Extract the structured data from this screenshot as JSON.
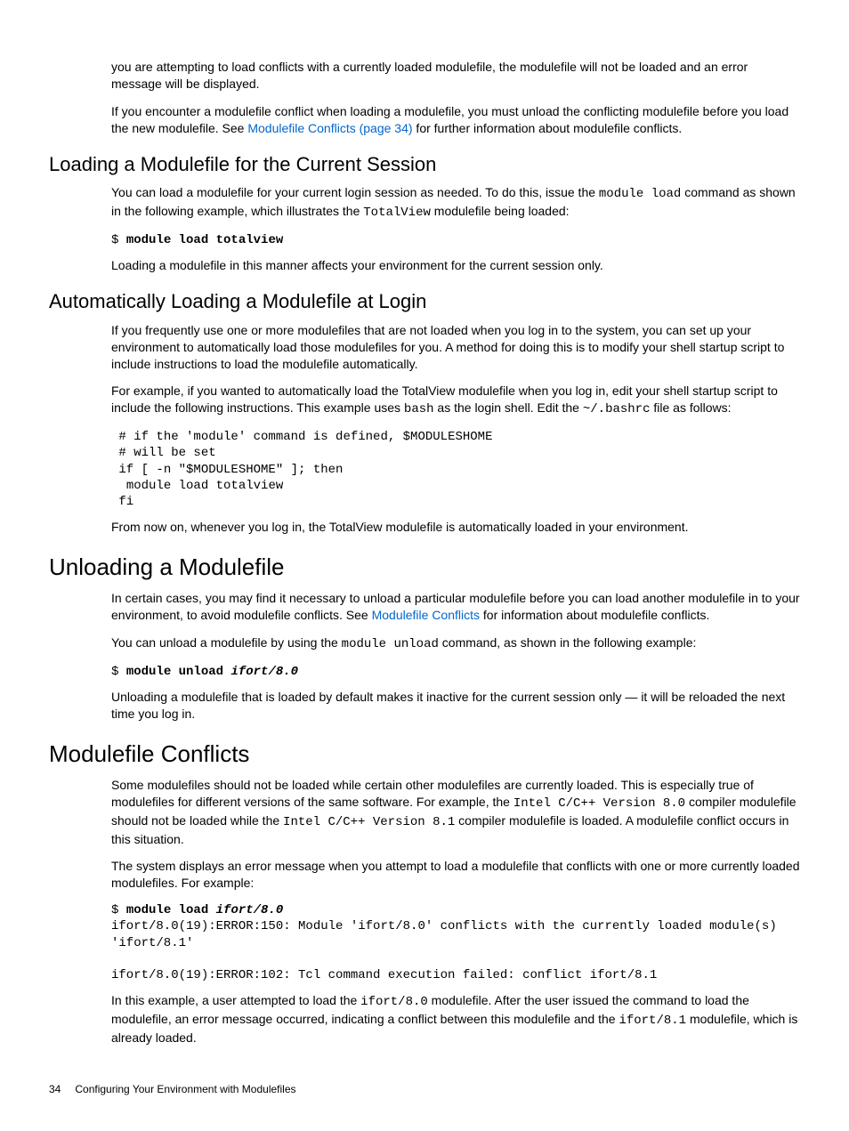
{
  "intro": {
    "p1": "you are attempting to load conflicts with a currently loaded modulefile, the modulefile will not be loaded and an error message will be displayed.",
    "p2a": "If you encounter a modulefile conflict when loading a modulefile, you must unload the conflicting modulefile before you load the new modulefile. See ",
    "p2link": "Modulefile Conflicts (page 34)",
    "p2b": " for further information about modulefile conflicts."
  },
  "loadingSession": {
    "heading": "Loading a Modulefile for the Current Session",
    "p1a": "You can load a modulefile for your current login session as needed. To do this, issue the ",
    "p1code1": "module load",
    "p1b": " command as shown in the following example, which illustrates the ",
    "p1code2": "TotalView",
    "p1c": " modulefile being loaded:",
    "cmdPrompt": "$ ",
    "cmd": "module load totalview",
    "p2": "Loading a modulefile in this manner affects your environment for the current session only."
  },
  "autoLoading": {
    "heading": "Automatically Loading a Modulefile at Login",
    "p1": "If you frequently use one or more modulefiles that are not loaded when you log in to the system, you can set up your environment to automatically load those modulefiles for you. A method for doing this is to modify your shell startup script to include instructions to load the modulefile automatically.",
    "p2a": "For example, if you wanted to automatically load the TotalView modulefile when you log in, edit your shell startup script to include the following instructions. This example uses ",
    "p2code1": "bash",
    "p2b": " as the login shell. Edit the ",
    "p2code2": "~/.bashrc",
    "p2c": " file as follows:",
    "code": " # if the 'module' command is defined, $MODULESHOME\n # will be set\n if [ -n \"$MODULESHOME\" ]; then\n  module load totalview\n fi",
    "p3": "From now on, whenever you log in, the TotalView modulefile is automatically loaded in your environment."
  },
  "unloading": {
    "heading": "Unloading a Modulefile",
    "p1a": "In certain cases, you may find it necessary to unload a particular modulefile before you can load another modulefile in to your environment, to avoid modulefile conflicts. See ",
    "p1link": "Modulefile Conflicts",
    "p1b": " for information about modulefile conflicts.",
    "p2a": "You can unload a modulefile by using the ",
    "p2code": "module unload",
    "p2b": " command, as shown in the following example:",
    "cmdPrompt": "$ ",
    "cmdBold": "module unload ",
    "cmdItalic": "ifort/8.0",
    "p3": "Unloading a modulefile that is loaded by default makes it inactive for the current session only — it will be reloaded the next time you log in."
  },
  "conflicts": {
    "heading": "Modulefile Conflicts",
    "p1a": "Some modulefiles should not be loaded while certain other modulefiles are currently loaded. This is especially true of modulefiles for different versions of the same software. For example, the ",
    "p1code1": "Intel C/C++ Version 8.0",
    "p1b": " compiler modulefile should not be loaded while the ",
    "p1code2": "Intel C/C++ Version 8.1",
    "p1c": " compiler modulefile is loaded. A modulefile conflict occurs in this situation.",
    "p2": "The system displays an error message when you attempt to load a modulefile that conflicts with one or more currently loaded modulefiles. For example:",
    "cmdPrompt": "$ ",
    "cmdBold": "module load ",
    "cmdItalic": "ifort/8.0",
    "output": "ifort/8.0(19):ERROR:150: Module 'ifort/8.0' conflicts with the currently loaded module(s) 'ifort/8.1'\n\nifort/8.0(19):ERROR:102: Tcl command execution failed: conflict ifort/8.1",
    "p3a": "In this example, a user attempted to load the ",
    "p3code1": "ifort/8.0",
    "p3b": " modulefile. After the user issued the command to load the modulefile, an error message occurred, indicating a conflict between this modulefile and the ",
    "p3code2": "ifort/8.1",
    "p3c": " modulefile, which is already loaded."
  },
  "footer": {
    "page": "34",
    "label": "Configuring Your Environment with Modulefiles"
  }
}
